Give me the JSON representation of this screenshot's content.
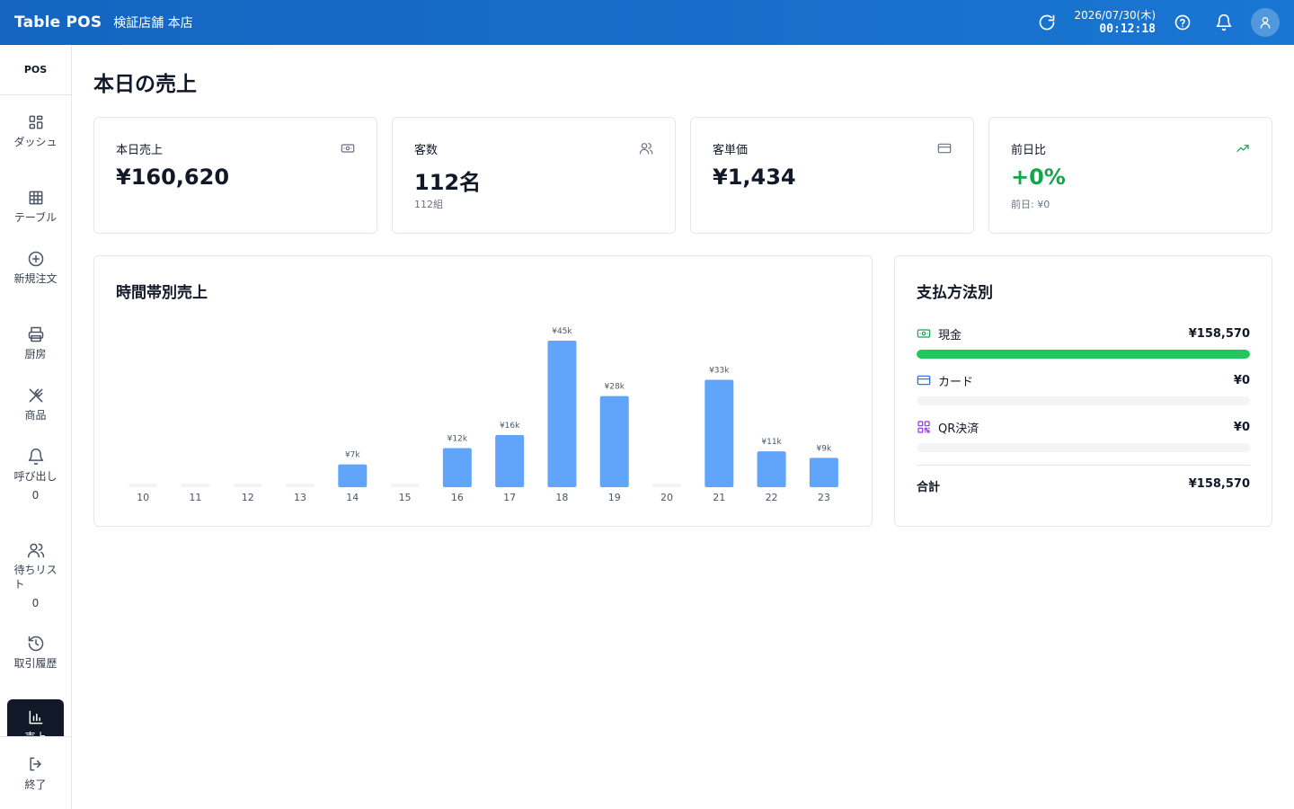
{
  "header": {
    "brand": "Table POS",
    "store": "検証店舗 本店",
    "date": "2026/07/30(木)",
    "time": "00:12:18"
  },
  "sidebar": {
    "title": "POS",
    "items": [
      {
        "label": "ダッシュ",
        "icon": "dashboard-icon"
      },
      {
        "label": "テーブル",
        "icon": "table-grid-icon"
      },
      {
        "label": "新規注文",
        "icon": "plus-circle-icon"
      },
      {
        "label": "厨房",
        "icon": "printer-icon"
      },
      {
        "label": "商品",
        "icon": "utensils-icon"
      },
      {
        "label": "呼び出し",
        "icon": "bell-icon",
        "count": "0"
      },
      {
        "label": "待ちリスト",
        "icon": "users-icon",
        "count": "0"
      },
      {
        "label": "取引履歴",
        "icon": "history-icon"
      },
      {
        "label": "売上",
        "icon": "bar-chart-icon",
        "active": true
      }
    ],
    "exit_label": "終了"
  },
  "page": {
    "title": "本日の売上"
  },
  "stats": [
    {
      "label": "本日売上",
      "value": "¥160,620",
      "sub": "",
      "icon": "banknote-icon"
    },
    {
      "label": "客数",
      "value": "112名",
      "sub": "112組",
      "icon": "users-icon"
    },
    {
      "label": "客単価",
      "value": "¥1,434",
      "sub": "",
      "icon": "credit-card-icon"
    },
    {
      "label": "前日比",
      "value": "+0%",
      "sub": "前日: ¥0",
      "icon": "trending-up-icon",
      "value_color": "#16a34a"
    }
  ],
  "hourly": {
    "title": "時間帯別売上"
  },
  "chart_data": {
    "type": "bar",
    "categories": [
      "10",
      "11",
      "12",
      "13",
      "14",
      "15",
      "16",
      "17",
      "18",
      "19",
      "20",
      "21",
      "22",
      "23"
    ],
    "values": [
      0,
      0,
      0,
      0,
      7000,
      0,
      12000,
      16000,
      45000,
      28000,
      0,
      33000,
      11000,
      9000
    ],
    "data_labels": [
      "",
      "",
      "",
      "",
      "¥7k",
      "",
      "¥12k",
      "¥16k",
      "¥45k",
      "¥28k",
      "",
      "¥33k",
      "¥11k",
      "¥9k"
    ],
    "ylim": [
      0,
      45000
    ],
    "bar_color": "#60a5fa",
    "empty_color": "#f3f4f6",
    "grid": false
  },
  "payment": {
    "title": "支払方法別",
    "methods": [
      {
        "name": "現金",
        "amount": "¥158,570",
        "ratio": 1.0,
        "icon": "banknote-icon",
        "color": "#16a34a"
      },
      {
        "name": "カード",
        "amount": "¥0",
        "ratio": 0,
        "icon": "credit-card-icon",
        "color": "#2563eb"
      },
      {
        "name": "QR決済",
        "amount": "¥0",
        "ratio": 0,
        "icon": "qr-code-icon",
        "color": "#9333ea"
      }
    ],
    "total_label": "合計",
    "total_value": "¥158,570"
  }
}
